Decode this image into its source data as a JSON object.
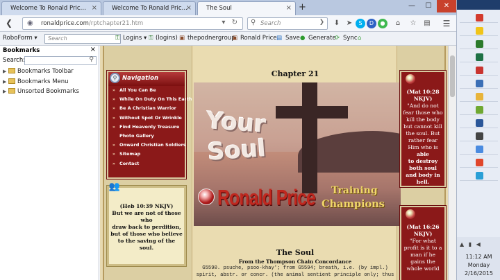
{
  "browser": {
    "tabs": [
      {
        "title": "Welcome To Ronald Price Mar..."
      },
      {
        "title": "Welcome To Ronald Price Trai..."
      },
      {
        "title": "The Soul"
      }
    ],
    "new_tab": "+",
    "win_controls": {
      "minimize": "—",
      "maximize": "☐",
      "close": "✕"
    },
    "url": {
      "host": "ronaldprice.com",
      "path": "/rptchapter21.htm"
    },
    "search_placeholder": "Search",
    "bookmarks_bar": {
      "roboform": "RoboForm",
      "search_placeholder": "Search",
      "logins": "Logins",
      "logins2": "(logins)",
      "podner": "thepodnergroup",
      "ronald": "Ronald Price",
      "save": "Save",
      "generate": "Generate",
      "sync": "Sync"
    }
  },
  "sidebar": {
    "title": "Bookmarks",
    "close": "×",
    "search_label": "Search:",
    "items": [
      {
        "label": "Bookmarks Toolbar"
      },
      {
        "label": "Bookmarks Menu"
      },
      {
        "label": "Unsorted Bookmarks"
      }
    ]
  },
  "nav": {
    "title": "Navigation",
    "links": [
      "All You Can Be",
      "While On Duty On This Earth",
      "Be A Christian Warrior",
      "Without Spot Or Wrinkle",
      "Find Heavenly Treasure",
      "Photo Gallery",
      "Onward Christian Soldiers",
      "Sitemap",
      "Contact"
    ]
  },
  "heb": {
    "ref": "(Heb 10:39 NKJV)",
    "l1": "But we are not of those who",
    "l2": "draw back to perdition,",
    "l3": "but of those who believe",
    "l4": "to the saving of the soul."
  },
  "main": {
    "chapter": "Chapter 21",
    "hero": {
      "your": "Your",
      "soul": "Soul",
      "name": "Ronald Price",
      "training": "Training",
      "champions": "Champions"
    },
    "soul_title": "The Soul",
    "concordance": "From the Thompson Chain Concordance",
    "body1": "G5590. psuche, psoo-khay'; from G5594; breath, i.e. (by impl.)",
    "body2": "spirit, abstr. or concr. (the animal sentient principle only; thus"
  },
  "verse1": {
    "ref": "(Mat 10:28 NKJV)",
    "text": "\"And do not fear those who kill the body but cannot kill the soul. But rather fear Him who is",
    "b1": "able",
    "b2": "to destroy both soul and body in hell."
  },
  "verse2": {
    "ref": "(Mat 16:26 NKJV)",
    "text": "\"For what profit is it to a man if he gains the whole world"
  },
  "taskbar": {
    "time": "11:12 AM",
    "day": "Monday",
    "date": "2/16/2015",
    "apps": [
      {
        "color": "#d33a2c"
      },
      {
        "color": "#f0c419"
      },
      {
        "color": "#2b7a2b"
      },
      {
        "color": "#1e7145"
      },
      {
        "color": "#c9342f"
      },
      {
        "color": "#3b6fb6"
      },
      {
        "color": "#e8b43a"
      },
      {
        "color": "#6fa832"
      },
      {
        "color": "#2a5699"
      },
      {
        "color": "#444444"
      },
      {
        "color": "#4a8be0"
      },
      {
        "color": "#e0462b"
      },
      {
        "color": "#2a9fd6"
      }
    ]
  }
}
